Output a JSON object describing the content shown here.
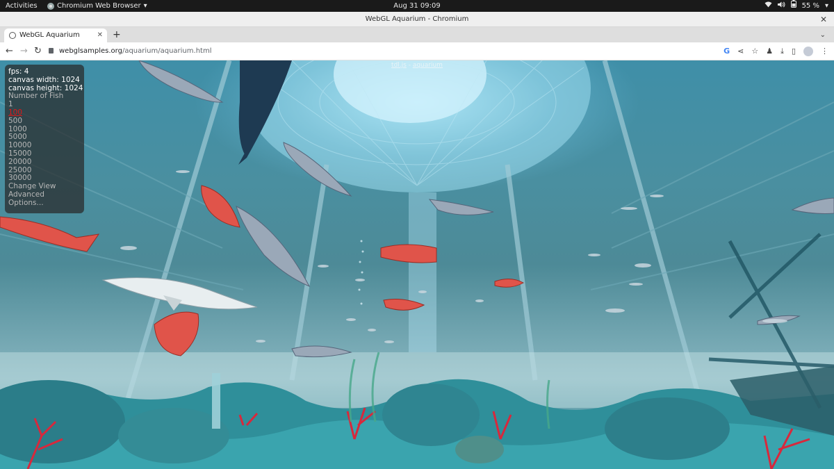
{
  "system_bar": {
    "activities": "Activities",
    "app_name": "Chromium Web Browser",
    "clock": "Aug 31  09:09",
    "battery": "55 %"
  },
  "window": {
    "title": "WebGL Aquarium - Chromium"
  },
  "tabs": [
    {
      "label": "WebGL Aquarium"
    }
  ],
  "address_bar": {
    "host": "webglsamples.org",
    "path": "/aquarium/aquarium.html"
  },
  "page": {
    "top_link_1": "tdl.js",
    "top_link_sep": " - ",
    "top_link_2": "aquarium",
    "stats": {
      "fps": "fps: 4",
      "canvas_width": "canvas width: 1024",
      "canvas_height": "canvas height: 1024"
    },
    "number_of_fish_label": "Number of Fish",
    "fish_options": [
      "1",
      "100",
      "500",
      "1000",
      "5000",
      "10000",
      "15000",
      "20000",
      "25000",
      "30000"
    ],
    "selected_fish": "100",
    "menu": [
      "Change View",
      "Advanced",
      "Options..."
    ]
  },
  "colors": {
    "selected_option": "#e01818",
    "water": "#4a8fa0"
  }
}
